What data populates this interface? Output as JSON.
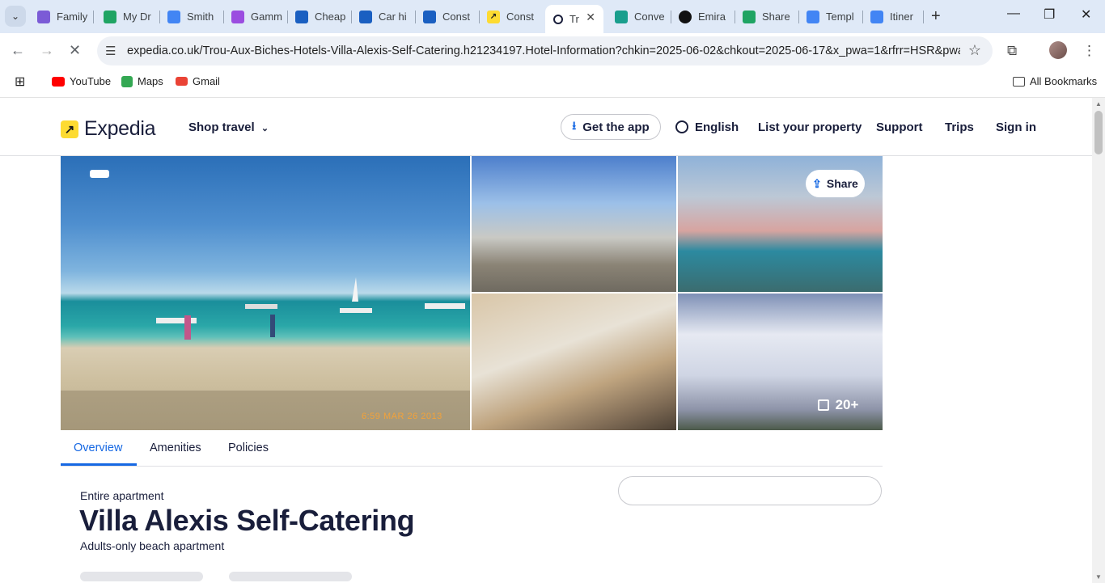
{
  "browser": {
    "tabs": [
      {
        "label": "Family",
        "color": "#7b5bd6"
      },
      {
        "label": "My Dr",
        "color": "#1fa463"
      },
      {
        "label": "Smith",
        "color": "#4285f4"
      },
      {
        "label": "Gamm",
        "color": "#9b4de0"
      },
      {
        "label": "Cheap",
        "color": "#1a5fc1"
      },
      {
        "label": "Car hi",
        "color": "#1a5fc1"
      },
      {
        "label": "Const",
        "color": "#1a5fc1"
      },
      {
        "label": "Const",
        "color": "#fddb32"
      },
      {
        "label": "Tr",
        "color": "#191e3b"
      },
      {
        "label": "Conve",
        "color": "#199e8d"
      },
      {
        "label": "Emira",
        "color": "#111111"
      },
      {
        "label": "Share",
        "color": "#1fa463"
      },
      {
        "label": "Templ",
        "color": "#4285f4"
      },
      {
        "label": "Itiner",
        "color": "#4285f4"
      }
    ],
    "url": "expedia.co.uk/Trou-Aux-Biches-Hotels-Villa-Alexis-Self-Catering.h21234197.Hotel-Information?chkin=2025-06-02&chkout=2025-06-17&x_pwa=1&rfrr=HSR&pwa_t...",
    "bookmarks": [
      {
        "label": "YouTube",
        "color": "#ff0000"
      },
      {
        "label": "Maps",
        "color": "#34a853"
      },
      {
        "label": "Gmail",
        "color": "#ea4335"
      }
    ],
    "all_bookmarks": "All Bookmarks"
  },
  "header": {
    "logo": "Expedia",
    "shop_travel": "Shop travel",
    "get_app": "Get the app",
    "language": "English",
    "list_property": "List your property",
    "support": "Support",
    "trips": "Trips",
    "sign_in": "Sign in"
  },
  "gallery": {
    "share": "Share",
    "photo_count": "20+",
    "stamp": "6:59 MAR 26 2013"
  },
  "page_tabs": [
    "Overview",
    "Amenities",
    "Policies"
  ],
  "property": {
    "type": "Entire apartment",
    "name": "Villa Alexis Self-Catering",
    "subtitle": "Adults-only beach apartment"
  },
  "colors": {
    "accent": "#1668e3",
    "brand_yellow": "#fddb32",
    "navy": "#191e3b"
  }
}
